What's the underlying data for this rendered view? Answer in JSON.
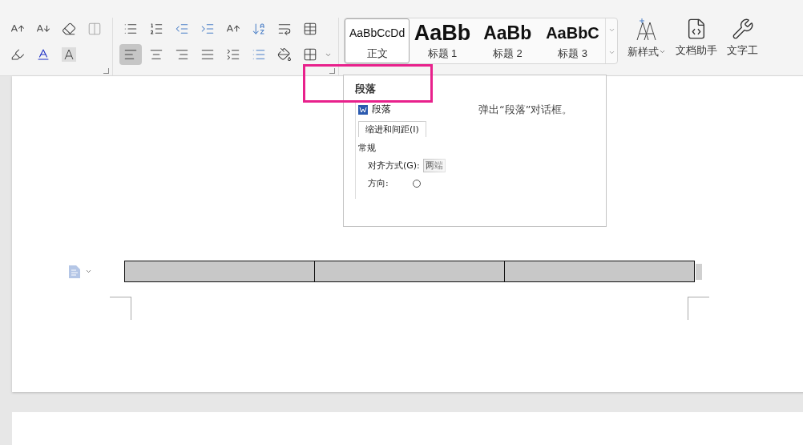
{
  "ribbon": {
    "alignment_buttons": [
      {
        "kind": "left",
        "selected": true
      },
      {
        "kind": "center",
        "selected": false
      },
      {
        "kind": "right",
        "selected": false
      },
      {
        "kind": "justify",
        "selected": false
      }
    ],
    "styles": [
      {
        "sample": "AaBbCcDd",
        "label": "正文",
        "selected": true,
        "kind": "body"
      },
      {
        "sample": "AaBb",
        "label": "标题 1",
        "selected": false,
        "kind": "h1"
      },
      {
        "sample": "AaBb",
        "label": "标题 2",
        "selected": false,
        "kind": "h2"
      },
      {
        "sample": "AaBbC",
        "label": "标题 3",
        "selected": false,
        "kind": "h3"
      }
    ],
    "new_style": "新样式",
    "tools": [
      "文档助手",
      "文字工"
    ]
  },
  "tooltip": {
    "title": "段落",
    "description": "弹出“段落”对话框。",
    "preview": {
      "title": "段落",
      "tab": "缩进和间距(I)",
      "section": "常规",
      "alignment_label": "对齐方式(G):",
      "alignment_value": "两端",
      "direction_label": "方向:"
    }
  }
}
